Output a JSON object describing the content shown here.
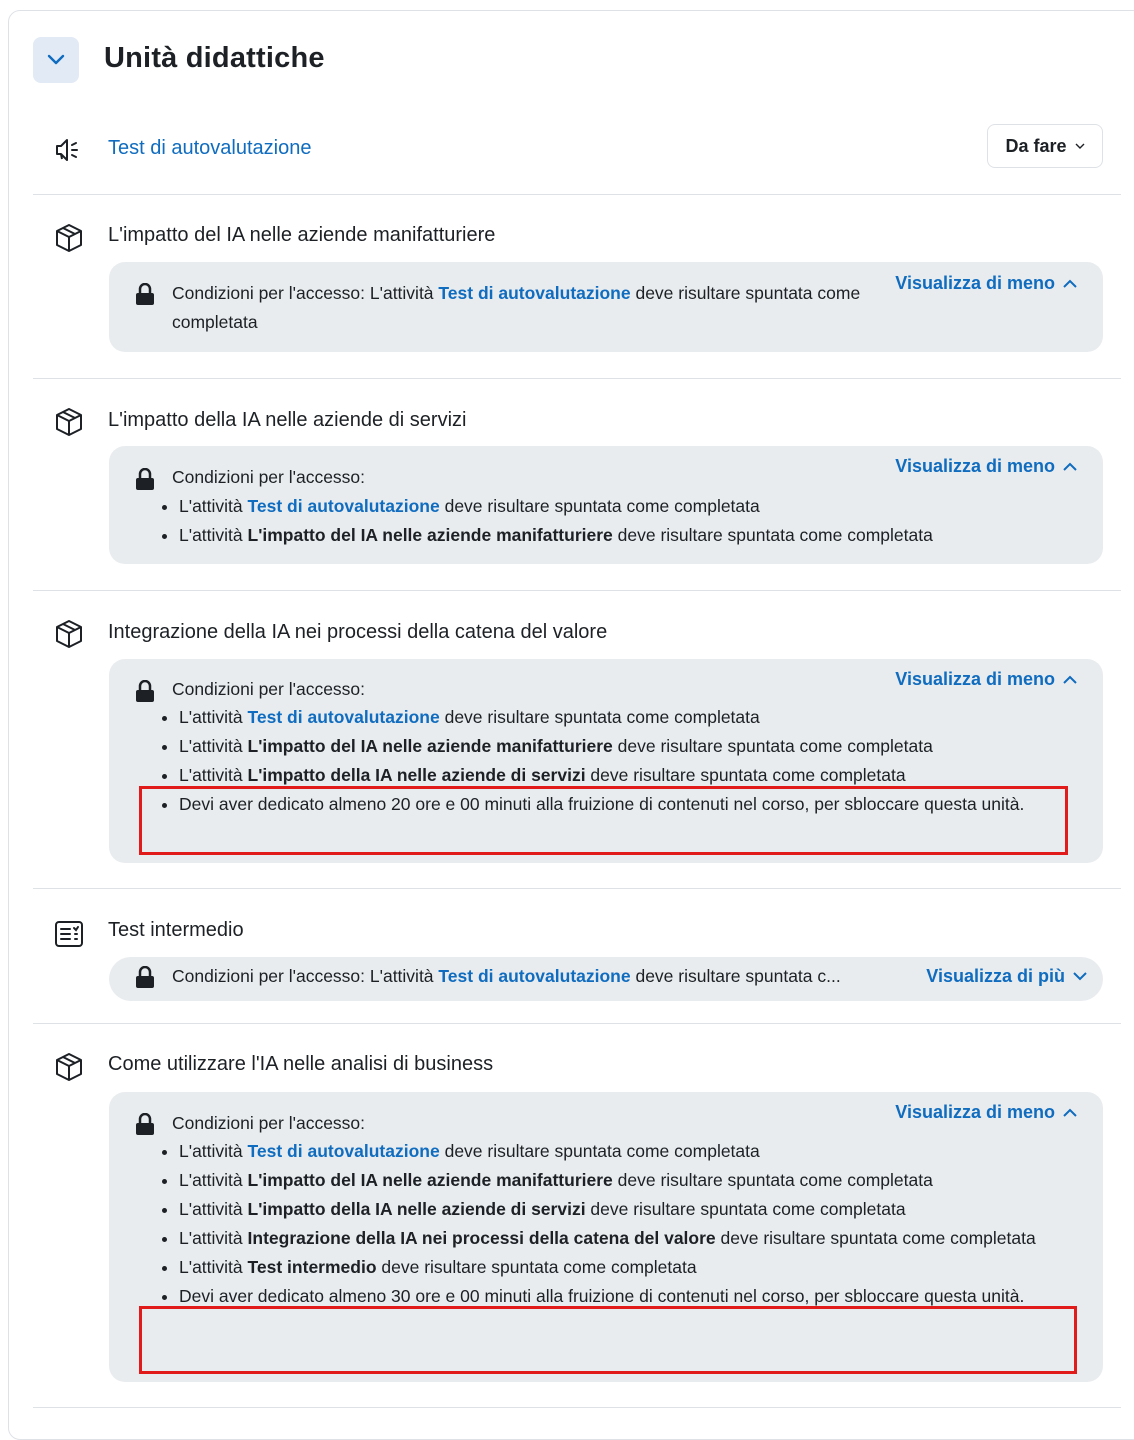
{
  "section": {
    "title": "Unità didattiche"
  },
  "activities": [
    {
      "name": "Test di autovalutazione",
      "icon": "megaphone-icon",
      "completion_button": "Da fare"
    },
    {
      "name": "L'impatto del IA nelle aziende manifatturiere",
      "icon": "cube-icon",
      "restriction": {
        "prefix": "Condizioni per l'accesso: L'attività ",
        "link": "Test di autovalutazione",
        "suffix": " deve risultare spuntata come completata",
        "toggle": "Visualizza di meno"
      }
    },
    {
      "name": "L'impatto della IA nelle aziende di servizi",
      "icon": "cube-icon",
      "restriction": {
        "heading": "Condizioni per l'accesso:",
        "toggle": "Visualizza di meno",
        "items": [
          {
            "pre": "L'attività ",
            "ref": "Test di autovalutazione",
            "post": " deve risultare spuntata come completata"
          },
          {
            "pre": "L'attività ",
            "ref": "L'impatto del IA nelle aziende manifatturiere",
            "post": " deve risultare spuntata come completata"
          }
        ]
      }
    },
    {
      "name": "Integrazione della IA nei processi della catena del valore",
      "icon": "cube-icon",
      "restriction": {
        "heading": "Condizioni per l'accesso:",
        "toggle": "Visualizza di meno",
        "items": [
          {
            "pre": "L'attività ",
            "ref": "Test di autovalutazione",
            "post": " deve risultare spuntata come completata"
          },
          {
            "pre": "L'attività ",
            "ref": "L'impatto del IA nelle aziende manifatturiere",
            "post": " deve risultare spuntata come completata"
          },
          {
            "pre": "L'attività ",
            "ref": "L'impatto della IA nelle aziende di servizi",
            "post": " deve risultare spuntata come completata"
          },
          {
            "text": "Devi aver dedicato almeno 20 ore e 00 minuti alla fruizione di contenuti nel corso, per sbloccare questa unità."
          }
        ]
      }
    },
    {
      "name": "Test intermedio",
      "icon": "quiz-icon",
      "restriction": {
        "prefix": "Condizioni per l'accesso: L'attività ",
        "link": "Test di autovalutazione",
        "suffix": " deve risultare spuntata c...",
        "toggle": "Visualizza di più"
      }
    },
    {
      "name": "Come utilizzare l'IA nelle analisi di business",
      "icon": "cube-icon",
      "restriction": {
        "heading": "Condizioni per l'accesso:",
        "toggle": "Visualizza di meno",
        "items": [
          {
            "pre": "L'attività ",
            "ref": "Test di autovalutazione",
            "post": " deve risultare spuntata come completata"
          },
          {
            "pre": "L'attività ",
            "ref": "L'impatto del IA nelle aziende manifatturiere",
            "post": " deve risultare spuntata come completata"
          },
          {
            "pre": "L'attività ",
            "ref": "L'impatto della IA nelle aziende di servizi",
            "post": " deve risultare spuntata come completata"
          },
          {
            "pre": "L'attività ",
            "ref": "Integrazione della IA nei processi della catena del valore",
            "post": " deve risultare spuntata come completata"
          },
          {
            "pre": "L'attività ",
            "ref": "Test intermedio",
            "post": " deve risultare spuntata come completata"
          },
          {
            "text": "Devi aver dedicato almeno 30 ore e 00 minuti alla fruizione di contenuti nel corso, per sbloccare questa unità."
          }
        ]
      }
    }
  ],
  "colors": {
    "link": "#0f6cbf",
    "restriction_bg": "#e9ecef",
    "highlight": "#e11a1a",
    "toggle_bg": "#e1eaf5"
  }
}
